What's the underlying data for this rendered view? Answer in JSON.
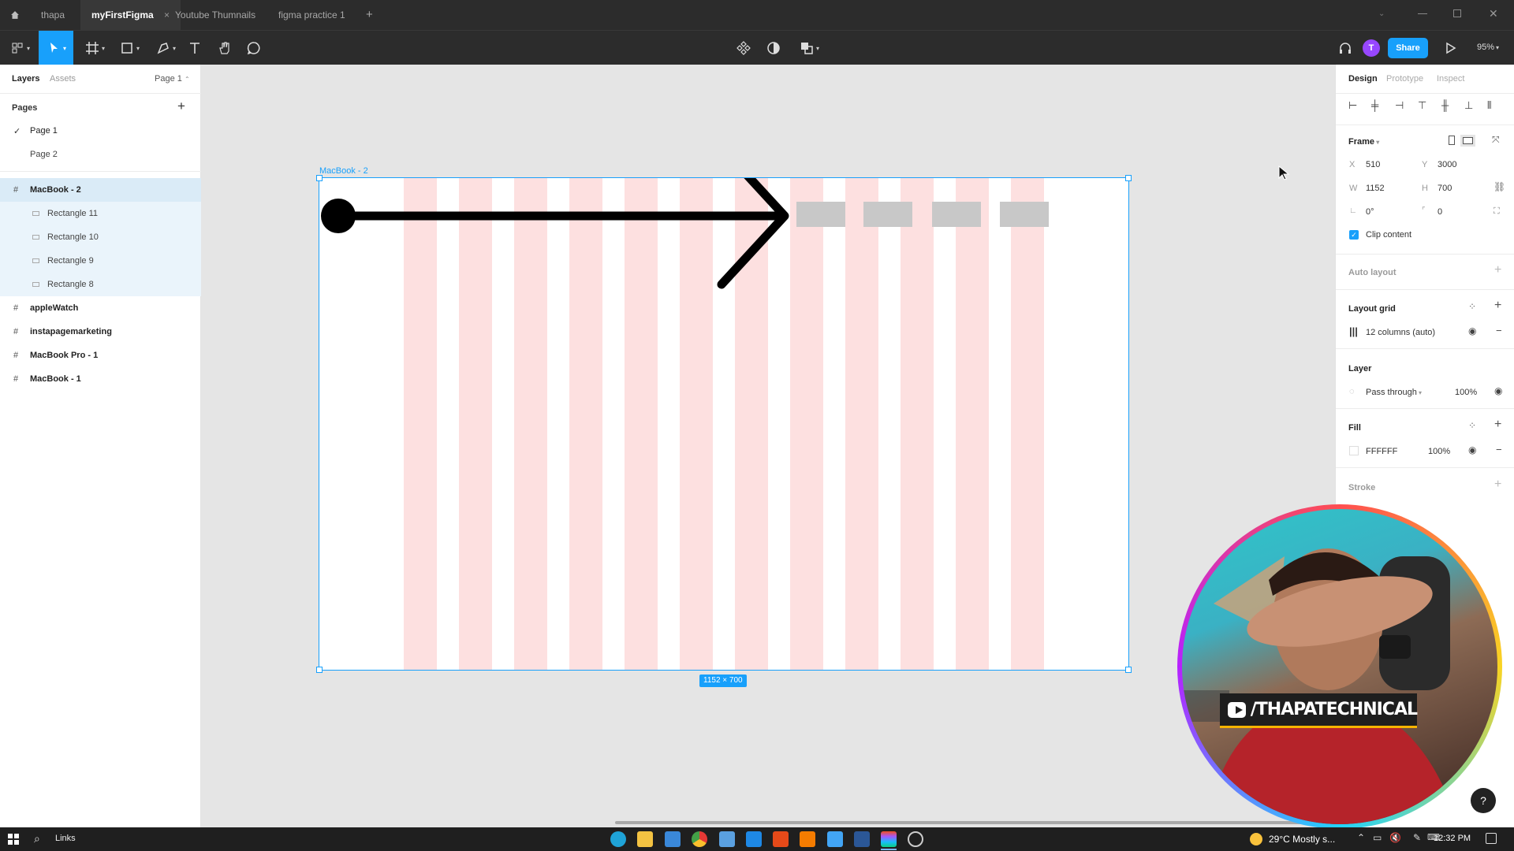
{
  "titlebar": {
    "tabs": [
      {
        "label": "thapa"
      },
      {
        "label": "myFirstFigma",
        "active": true
      },
      {
        "label": "Youtube Thumnails"
      },
      {
        "label": "figma practice 1"
      }
    ],
    "new_tab": "+"
  },
  "toolbar": {
    "share_label": "Share",
    "avatar_letter": "T",
    "zoom": "95%"
  },
  "left_panel": {
    "tabs": [
      "Layers",
      "Assets"
    ],
    "page_selector": "Page 1",
    "pages_header": "Pages",
    "pages": [
      "Page 1",
      "Page 2"
    ],
    "layers": [
      {
        "name": "MacBook - 2",
        "kind": "frame",
        "selected": true
      },
      {
        "name": "Rectangle 11",
        "kind": "rect"
      },
      {
        "name": "Rectangle 10",
        "kind": "rect"
      },
      {
        "name": "Rectangle 9",
        "kind": "rect"
      },
      {
        "name": "Rectangle 8",
        "kind": "rect"
      },
      {
        "name": "appleWatch",
        "kind": "frame"
      },
      {
        "name": "instapagemarketing",
        "kind": "frame"
      },
      {
        "name": "MacBook Pro - 1",
        "kind": "frame"
      },
      {
        "name": "MacBook - 1",
        "kind": "frame"
      }
    ]
  },
  "canvas": {
    "frame_name": "MacBook - 2",
    "size_badge": "1152 × 700",
    "grid_columns": 12,
    "grid_color": "#fde0e0",
    "selection_color": "#18a0fb"
  },
  "right_panel": {
    "tabs": [
      "Design",
      "Prototype",
      "Inspect"
    ],
    "frame_label": "Frame",
    "x_label": "X",
    "x_value": "510",
    "y_label": "Y",
    "y_value": "3000",
    "w_label": "W",
    "w_value": "1152",
    "h_label": "H",
    "h_value": "700",
    "rotation": "0°",
    "radius": "0",
    "clip_content": "Clip content",
    "auto_layout": "Auto layout",
    "layout_grid": "Layout grid",
    "grid_value": "12 columns (auto)",
    "layer": "Layer",
    "blend": "Pass through",
    "layer_opacity": "100%",
    "fill": "Fill",
    "fill_hex": "FFFFFF",
    "fill_opacity": "100%",
    "stroke": "Stroke"
  },
  "webcam": {
    "channel": "/THAPATECHNICAL",
    "help": "?"
  },
  "taskbar": {
    "search_label": "Links",
    "weather": "29°C  Mostly s...",
    "time": "12:32 PM"
  }
}
